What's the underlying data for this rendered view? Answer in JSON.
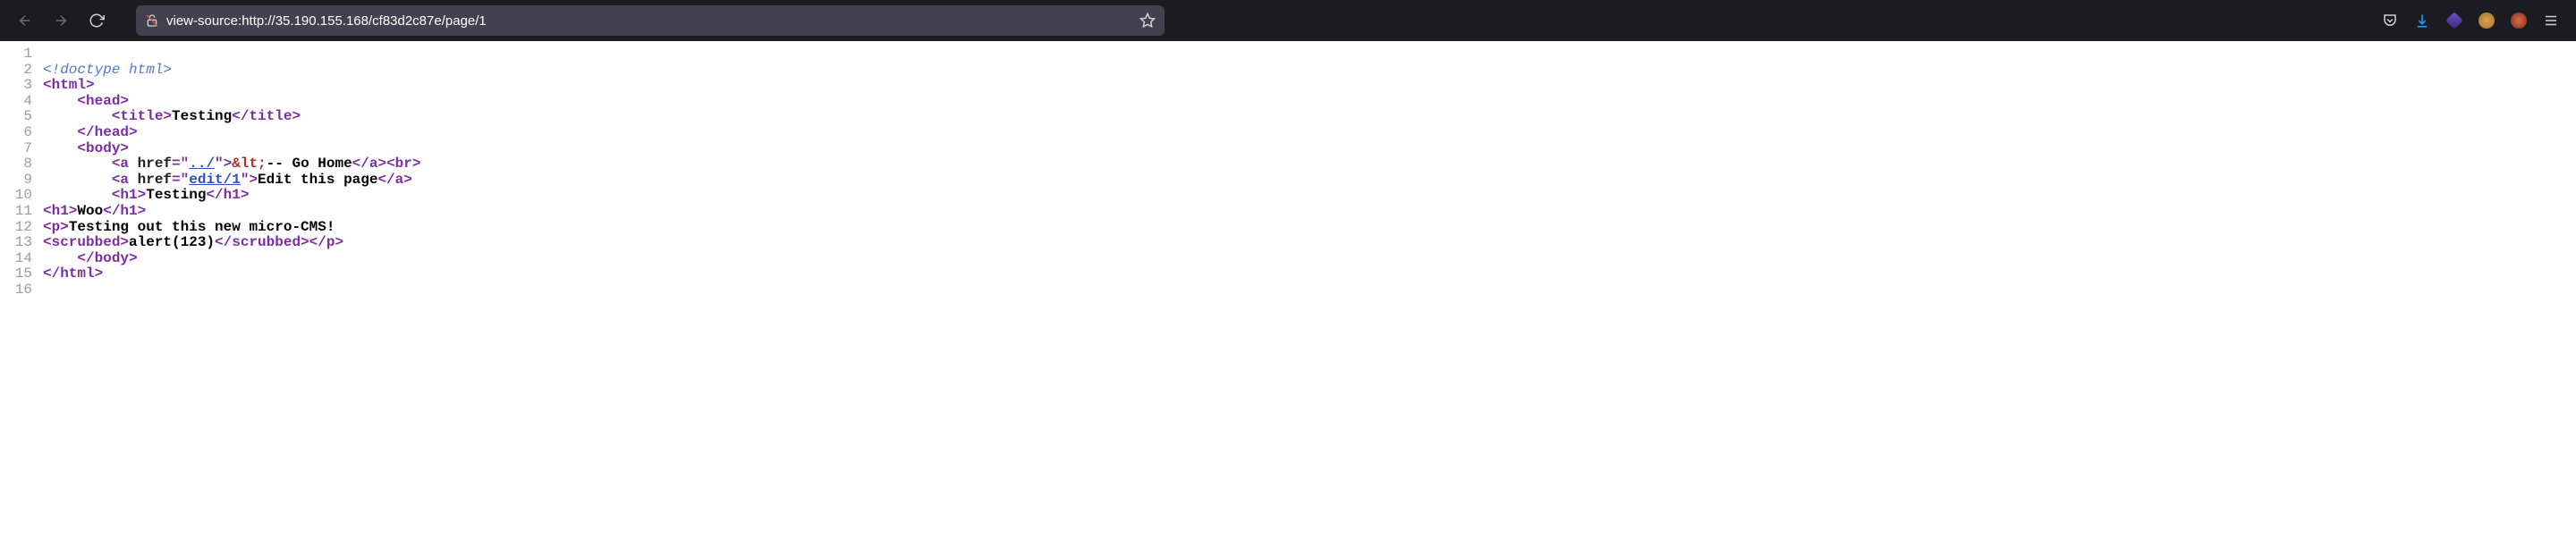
{
  "url": "view-source:http://35.190.155.168/cf83d2c87e/page/1",
  "icons": {
    "back": "back",
    "forward": "forward",
    "reload": "reload",
    "insecure": "insecure",
    "star": "star",
    "pocket": "pocket",
    "download": "download",
    "menu": "menu"
  },
  "source_lines": [
    {
      "n": "1",
      "parts": []
    },
    {
      "n": "2",
      "parts": [
        {
          "cls": "doctype",
          "t": "<!doctype html>"
        }
      ]
    },
    {
      "n": "3",
      "parts": [
        {
          "cls": "tag",
          "t": "<html>"
        }
      ]
    },
    {
      "n": "4",
      "parts": [
        {
          "cls": "plain",
          "t": "    "
        },
        {
          "cls": "tag",
          "t": "<head>"
        }
      ]
    },
    {
      "n": "5",
      "parts": [
        {
          "cls": "plain",
          "t": "        "
        },
        {
          "cls": "tag",
          "t": "<title>"
        },
        {
          "cls": "text",
          "t": "Testing"
        },
        {
          "cls": "tag",
          "t": "</title>"
        }
      ]
    },
    {
      "n": "6",
      "parts": [
        {
          "cls": "plain",
          "t": "    "
        },
        {
          "cls": "tag",
          "t": "</head>"
        }
      ]
    },
    {
      "n": "7",
      "parts": [
        {
          "cls": "plain",
          "t": "    "
        },
        {
          "cls": "tag",
          "t": "<body>"
        }
      ]
    },
    {
      "n": "8",
      "parts": [
        {
          "cls": "plain",
          "t": "        "
        },
        {
          "cls": "tag",
          "t": "<a "
        },
        {
          "cls": "attr-name",
          "t": "href"
        },
        {
          "cls": "tag",
          "t": "=\""
        },
        {
          "cls": "attr-val",
          "link": true,
          "t": "../"
        },
        {
          "cls": "tag",
          "t": "\">"
        },
        {
          "cls": "entity",
          "t": "&lt;"
        },
        {
          "cls": "text",
          "t": "-- Go Home"
        },
        {
          "cls": "tag",
          "t": "</a><br>"
        }
      ]
    },
    {
      "n": "9",
      "parts": [
        {
          "cls": "plain",
          "t": "        "
        },
        {
          "cls": "tag",
          "t": "<a "
        },
        {
          "cls": "attr-name",
          "t": "href"
        },
        {
          "cls": "tag",
          "t": "=\""
        },
        {
          "cls": "attr-val",
          "link": true,
          "t": "edit/1"
        },
        {
          "cls": "tag",
          "t": "\">"
        },
        {
          "cls": "text",
          "t": "Edit this page"
        },
        {
          "cls": "tag",
          "t": "</a>"
        }
      ]
    },
    {
      "n": "10",
      "parts": [
        {
          "cls": "plain",
          "t": "        "
        },
        {
          "cls": "tag",
          "t": "<h1>"
        },
        {
          "cls": "text",
          "t": "Testing"
        },
        {
          "cls": "tag",
          "t": "</h1>"
        }
      ]
    },
    {
      "n": "11",
      "parts": [
        {
          "cls": "tag",
          "t": "<h1>"
        },
        {
          "cls": "text",
          "t": "Woo"
        },
        {
          "cls": "tag",
          "t": "</h1>"
        }
      ]
    },
    {
      "n": "12",
      "parts": [
        {
          "cls": "tag",
          "t": "<p>"
        },
        {
          "cls": "text",
          "t": "Testing out this new micro-CMS!"
        }
      ]
    },
    {
      "n": "13",
      "parts": [
        {
          "cls": "tag",
          "t": "<scrubbed>"
        },
        {
          "cls": "text",
          "t": "alert(123)"
        },
        {
          "cls": "tag",
          "t": "</scrubbed></p>"
        }
      ]
    },
    {
      "n": "14",
      "parts": [
        {
          "cls": "plain",
          "t": "    "
        },
        {
          "cls": "tag",
          "t": "</body>"
        }
      ]
    },
    {
      "n": "15",
      "parts": [
        {
          "cls": "tag",
          "t": "</html>"
        }
      ]
    },
    {
      "n": "16",
      "parts": []
    }
  ]
}
